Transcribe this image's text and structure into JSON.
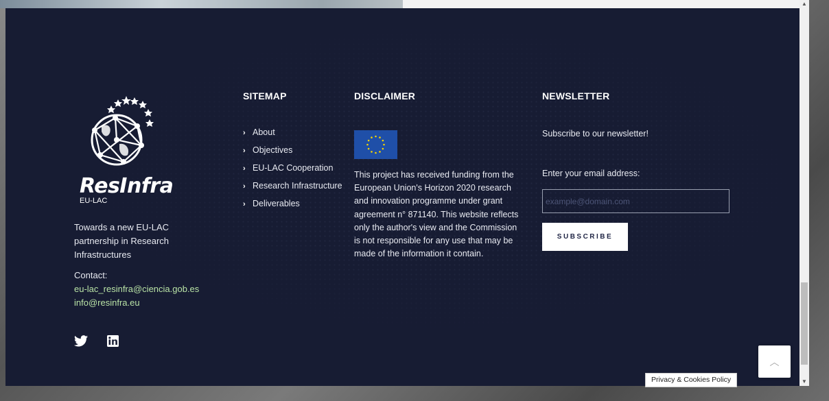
{
  "brand": {
    "name": "ResInfra",
    "sub": "EU-LAC",
    "tagline": "Towards a new EU-LAC partnership in Research Infrastructures",
    "contact_label": "Contact:",
    "contact_email_1": "eu-lac_resinfra@ciencia.gob.es",
    "contact_email_2": "info@resinfra.eu",
    "social": [
      "twitter-icon",
      "linkedin-icon"
    ]
  },
  "sitemap": {
    "title": "SITEMAP",
    "items": [
      {
        "label": "About"
      },
      {
        "label": "Objectives"
      },
      {
        "label": "EU-LAC Cooperation"
      },
      {
        "label": "Research Infrastructure"
      },
      {
        "label": "Deliverables"
      }
    ]
  },
  "disclaimer": {
    "title": "DISCLAIMER",
    "text": "This project has received funding from the European Union's Horizon 2020 research and innovation programme under grant agreement n° 871140. This website reflects only the author's view and the Commission is not responsible for any use that may be made of the information it contain."
  },
  "newsletter": {
    "title": "NEWSLETTER",
    "subtitle": "Subscribe to our newsletter!",
    "email_label": "Enter your email address:",
    "email_placeholder": "example@domain.com",
    "email_value": "",
    "subscribe_label": "SUBSCRIBE"
  },
  "privacy_label": "Privacy & Cookies Policy",
  "colors": {
    "footer_bg": "#171c33",
    "link_green": "#b9e3a6",
    "eu_blue": "#1f4fa8",
    "eu_yellow": "#f6d400"
  }
}
